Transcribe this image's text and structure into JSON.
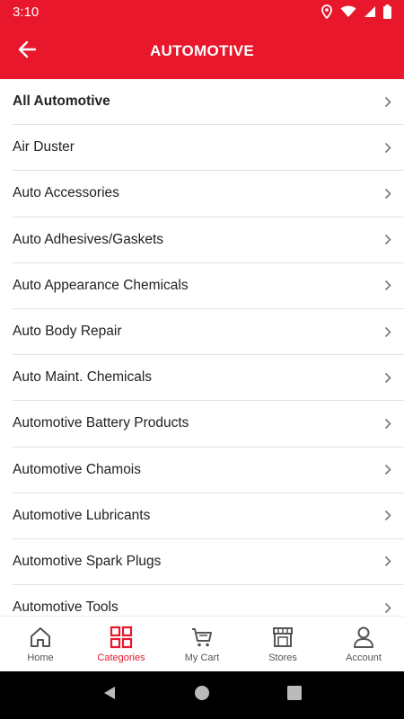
{
  "status_bar": {
    "time": "3:10"
  },
  "header": {
    "title": "AUTOMOTIVE",
    "back_icon": "arrow-left-icon"
  },
  "categories": [
    {
      "label": "All Automotive"
    },
    {
      "label": "Air Duster"
    },
    {
      "label": "Auto Accessories"
    },
    {
      "label": "Auto Adhesives/Gaskets"
    },
    {
      "label": "Auto Appearance Chemicals"
    },
    {
      "label": "Auto Body Repair"
    },
    {
      "label": "Auto Maint. Chemicals"
    },
    {
      "label": "Automotive Battery Products"
    },
    {
      "label": "Automotive Chamois"
    },
    {
      "label": "Automotive Lubricants"
    },
    {
      "label": "Automotive Spark Plugs"
    },
    {
      "label": "Automotive Tools"
    }
  ],
  "bottom_nav": {
    "items": [
      {
        "label": "Home",
        "icon": "home-icon"
      },
      {
        "label": "Categories",
        "icon": "grid-icon",
        "active": true
      },
      {
        "label": "My Cart",
        "icon": "cart-icon"
      },
      {
        "label": "Stores",
        "icon": "store-icon"
      },
      {
        "label": "Account",
        "icon": "user-icon"
      }
    ]
  },
  "colors": {
    "accent": "#e8172c",
    "nav_inactive": "#555555",
    "divider": "#e2e2e2"
  }
}
